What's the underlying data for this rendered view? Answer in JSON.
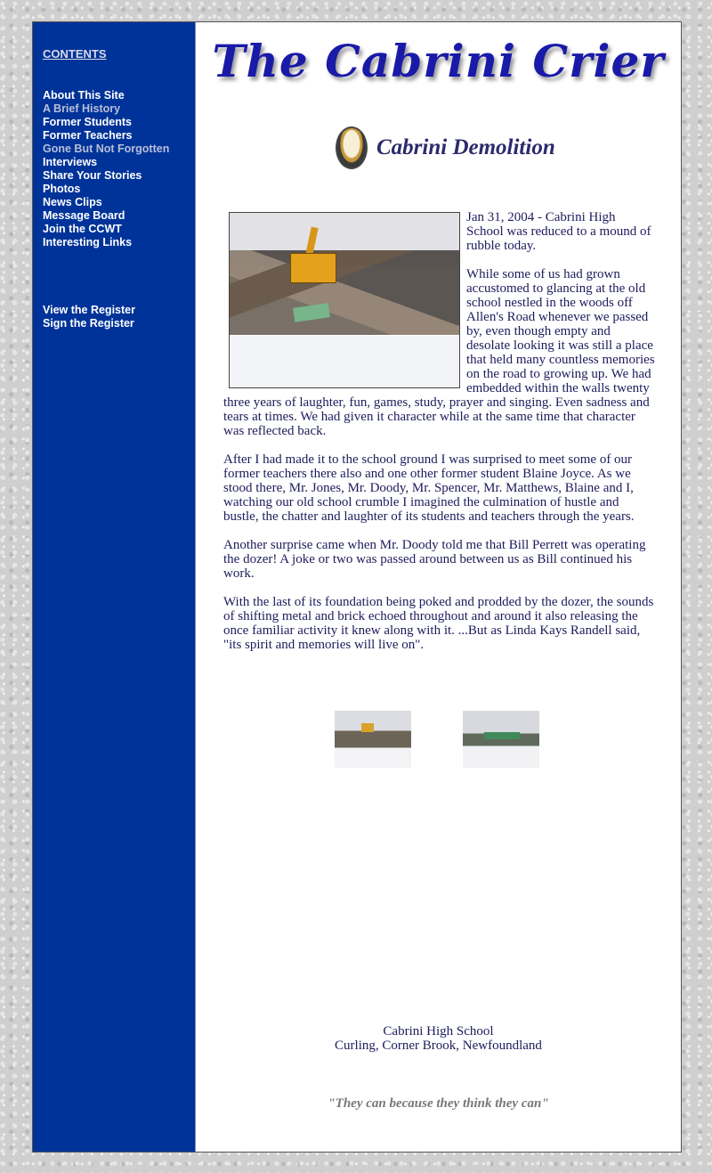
{
  "sidebar": {
    "contents_label": "CONTENTS",
    "nav": [
      {
        "label": "About This Site"
      },
      {
        "label": "A Brief History"
      },
      {
        "label": "Former Students"
      },
      {
        "label": "Former Teachers"
      },
      {
        "label": "Gone But Not Forgotten"
      },
      {
        "label": "Interviews"
      },
      {
        "label": "Share Your Stories"
      },
      {
        "label": "Photos"
      },
      {
        "label": "News Clips"
      },
      {
        "label": "Message Board"
      },
      {
        "label": "Join the CCWT"
      },
      {
        "label": "Interesting Links"
      }
    ],
    "register": [
      {
        "label": "View the Register"
      },
      {
        "label": "Sign the Register"
      }
    ]
  },
  "header": {
    "banner": "The Cabrini Crier",
    "page_title": "Cabrini Demolition",
    "crest_icon": "school-crest-icon"
  },
  "article": {
    "paragraphs": [
      "Jan 31, 2004 - Cabrini High School was reduced to a mound of rubble today.",
      "While some of us had grown accustomed to glancing at the old school nestled in the woods off Allen's Road whenever we passed by, even though empty and desolate looking it was still a place that held many countless memories on the road to growing up.  We had embedded within the walls twenty three years of laughter, fun, games, study, prayer and singing.  Even sadness and tears at times.  We had given it character while at the same time that character was reflected back.",
      "After I had made it to the school ground I was surprised to meet some of our former teachers there also and one other former student Blaine Joyce.  As we stood there, Mr. Jones, Mr. Doody, Mr. Spencer, Mr. Matthews, Blaine and I, watching our old school crumble I imagined the culmination of hustle and bustle, the chatter and laughter of its students and teachers through the years.",
      "Another surprise came when Mr. Doody told me that Bill Perrett was operating the dozer!  A joke or two was passed around between us as Bill continued his work.",
      "With the last of its foundation being poked and prodded by the dozer, the sounds of shifting metal and brick echoed throughout and around it also releasing the once familiar activity it knew along with it.  ...But as Linda Kays Randell said, \"its spirit and memories will live on\"."
    ]
  },
  "footer": {
    "line1": "Cabrini High School",
    "line2": "Curling, Corner Brook, Newfoundland",
    "motto": "\"They can because they think they can\""
  },
  "colors": {
    "sidebar_bg": "#003399",
    "text": "#1c1c5c",
    "banner": "#1a1aa8",
    "motto": "#777777"
  }
}
